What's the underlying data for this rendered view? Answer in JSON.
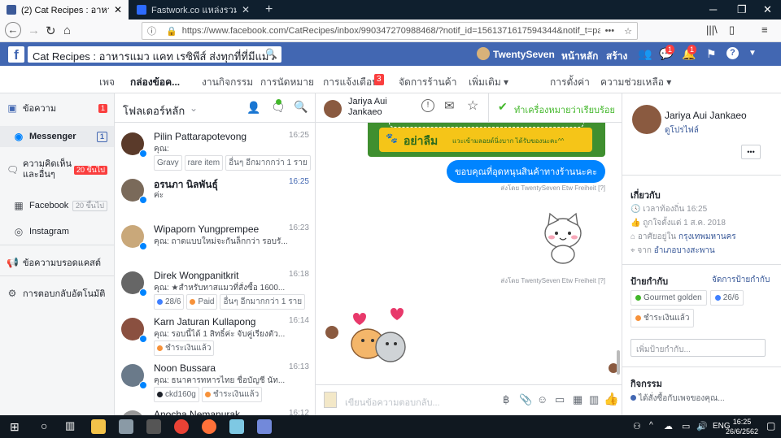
{
  "browser": {
    "tabs": [
      {
        "title": "(2) Cat Recipes : อาหารแมว แค",
        "active": true
      },
      {
        "title": "Fastwork.co แหล่งรวมฟรีแลนซ์ค",
        "active": false
      }
    ],
    "new_tab_label": "+",
    "url": "https://www.facebook.com/CatRecipes/inbox/990347270988468/?notif_id=1561371617594344&notif_t=page_"
  },
  "fb": {
    "logo": "f",
    "search_text": "Cat Recipes : อาหารแมว แคท เรซิพีส์ ส่งทุกที่ที่มีแมว",
    "user_name": "TwentySeven",
    "home_label": "หน้าหลัก",
    "create_label": "สร้าง",
    "msg_badge": "1",
    "notif_badge": "1"
  },
  "page_nav": {
    "items": [
      "เพจ",
      "กล่องข้อค...",
      "งานกิจกรรม",
      "การนัดหมาย",
      "การแจ้งเตือน",
      "จัดการร้านค้า",
      "เพิ่มเติม ▾"
    ],
    "notif_badge": "3",
    "settings": "การตั้งค่า",
    "help": "ความช่วยเหลือ ▾"
  },
  "sidebar": {
    "items": [
      {
        "label": "ข้อความ",
        "count": "1",
        "icon": "inbox-icon"
      },
      {
        "label": "Messenger",
        "count": "1",
        "icon": "messenger-icon"
      },
      {
        "label": "ความคิดเห็นและอื่นๆ",
        "count": "20 ขึ้นไป",
        "icon": "comment-icon"
      },
      {
        "label": "Facebook",
        "count": "20 ขึ้นไป",
        "icon": "facebook-icon"
      },
      {
        "label": "Instagram",
        "count": "",
        "icon": "instagram-icon"
      },
      {
        "label": "ข้อความบรอดแคสต์",
        "count": "",
        "icon": "broadcast-icon"
      },
      {
        "label": "การตอบกลับอัตโนมัติ",
        "count": "",
        "icon": "automation-icon"
      }
    ]
  },
  "conv_list": {
    "folder_label": "โฟลเดอร์หลัก",
    "conversations": [
      {
        "name": "Pilin Pattarapotevong",
        "time": "16:25",
        "preview": "คุณ:",
        "tags": [
          {
            "label": "Gravy",
            "color": ""
          },
          {
            "label": "rare item",
            "color": ""
          },
          {
            "label": "อื่นๆ อีกมากกว่า 1 ราย",
            "color": ""
          }
        ],
        "avatar_color": "#5a3a2a"
      },
      {
        "name": "อรนภา นิลพันธุ์",
        "time": "16:25",
        "preview": "ค่ะ",
        "tags": [],
        "avatar_color": "#7a6a5a",
        "bold": true
      },
      {
        "name": "Wipaporn Yungprempee",
        "time": "16:23",
        "preview": "คุณ: ถาดแบบใหม่จะกันล็กกว่า รอบรั...",
        "tags": [],
        "avatar_color": "#c9a87a"
      },
      {
        "name": "Direk Wongpanitkrit",
        "time": "16:18",
        "preview": "คุณ: ★สำหรับทาสแมวที่สั่งซื้อ 1600...",
        "tags": [
          {
            "label": "28/6",
            "color": "#4080ff"
          },
          {
            "label": "Paid",
            "color": "#f7923a"
          },
          {
            "label": "อื่นๆ อีกมากกว่า 1 ราย",
            "color": ""
          }
        ],
        "avatar_color": "#666"
      },
      {
        "name": "Karn Jaturan Kullapong",
        "time": "16:14",
        "preview": "คุณ: รอบนี้ได้ 1 สิทธิ์ค่ะ จับคู่เรียงตัว...",
        "tags": [
          {
            "label": "ชำระเงินแล้ว",
            "color": "#f7923a"
          }
        ],
        "avatar_color": "#8a5040"
      },
      {
        "name": "Noon Bussara",
        "time": "16:13",
        "preview": "คุณ: ธนาคารทหารไทย ชื่อบัญชี นัท...",
        "tags": [
          {
            "label": "ckd160g",
            "color": "#1d2129"
          },
          {
            "label": "ชำระเงินแล้ว",
            "color": "#f7923a"
          }
        ],
        "avatar_color": "#6a7a8a"
      },
      {
        "name": "Anocha Nemanurak",
        "time": "16:12",
        "preview": "",
        "tags": [],
        "avatar_color": "#999"
      }
    ]
  },
  "chat": {
    "name_line1": "Jariya Aui",
    "name_line2": "Jankaeo",
    "sub_text": "ตอบกลับใน: Cat...",
    "mark_done": "ทำเครื่องหมายว่าเรียบร้อย",
    "promo_text": "อย่าลืม",
    "promo_small": "แวะเข้ามลอยด์นิ่งบาก ได้รับของนะคะ^^",
    "bubble_text": "ขอบคุณที่อุดหนุนสินค้าทางร้านนะคะ",
    "sent_by_1": "ส่งโดย TwentySeven Etw Freiheit [?]",
    "sent_by_2": "ส่งโดย TwentySeven Etw Freiheit [?]",
    "composer_placeholder": "เขียนข้อความตอบกลับ..."
  },
  "right": {
    "name": "Jariya Aui Jankaeo",
    "profile_link": "ดูโปรไฟล์",
    "more": "•••",
    "about_title": "เกี่ยวกับ",
    "local_time": "เวลาท้องถิ่น 16:25",
    "liked": "ถูกใจตั้งแต่ 1 ส.ค. 2018",
    "lives_prefix": "อาศัยอยู่ใน",
    "lives_city": "กรุงเทพมหานคร",
    "from_prefix": "จาก",
    "from_city": "อำเภอบางสะพาน",
    "labels_title": "ป้ายกำกับ",
    "manage_labels": "จัดการป้ายกำกับ",
    "labels": [
      {
        "label": "Gourmet golden",
        "color": "#42b72a"
      },
      {
        "label": "26/6",
        "color": "#4080ff"
      },
      {
        "label": "ชำระเงินแล้ว",
        "color": "#f7923a"
      }
    ],
    "add_label_placeholder": "เพิ่มป้ายกำกับ...",
    "activity_title": "กิจกรรม",
    "activity_item": "ได้สั่งซื้อกับเพจของคุณ..."
  },
  "taskbar": {
    "lang": "ENG",
    "time": "16:25",
    "date": "26/6/2562"
  }
}
